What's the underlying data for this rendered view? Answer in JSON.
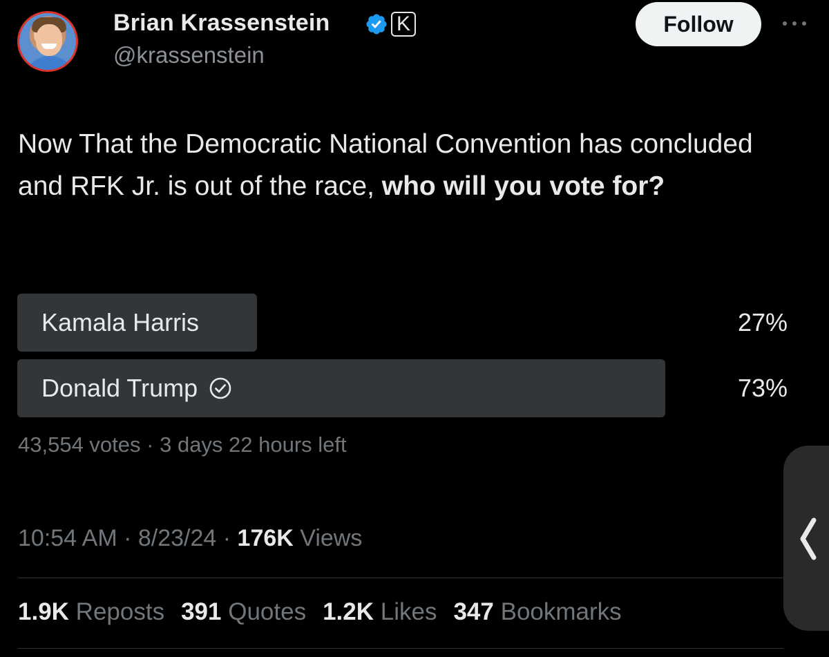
{
  "author": {
    "display_name": "Brian Krassenstein",
    "handle": "@krassenstein",
    "affiliate_badge": "K",
    "verified_color": "#1d9bf0"
  },
  "header": {
    "follow_label": "Follow",
    "more_icon": "more-horizontal-icon"
  },
  "tweet": {
    "text_plain": "Now That the Democratic National Convention has concluded and RFK Jr. is out of the race, ",
    "text_bold": "who will you vote for?"
  },
  "poll": {
    "options": [
      {
        "label": "Kamala Harris",
        "percent_text": "27%",
        "fraction": 0.27,
        "selected": false
      },
      {
        "label": "Donald Trump",
        "percent_text": "73%",
        "fraction": 0.73,
        "selected": true
      }
    ],
    "votes": "43,554 votes",
    "time_left": "3 days 22 hours left"
  },
  "meta": {
    "time": "10:54 AM",
    "date": "8/23/24",
    "views_count": "176K",
    "views_label": "Views"
  },
  "stats": [
    {
      "count": "1.9K",
      "label": "Reposts"
    },
    {
      "count": "391",
      "label": "Quotes"
    },
    {
      "count": "1.2K",
      "label": "Likes"
    },
    {
      "count": "347",
      "label": "Bookmarks"
    }
  ],
  "colors": {
    "background": "#000000",
    "text": "#e7e9ea",
    "secondary_text": "#71767b",
    "poll_bar": "#333639"
  }
}
